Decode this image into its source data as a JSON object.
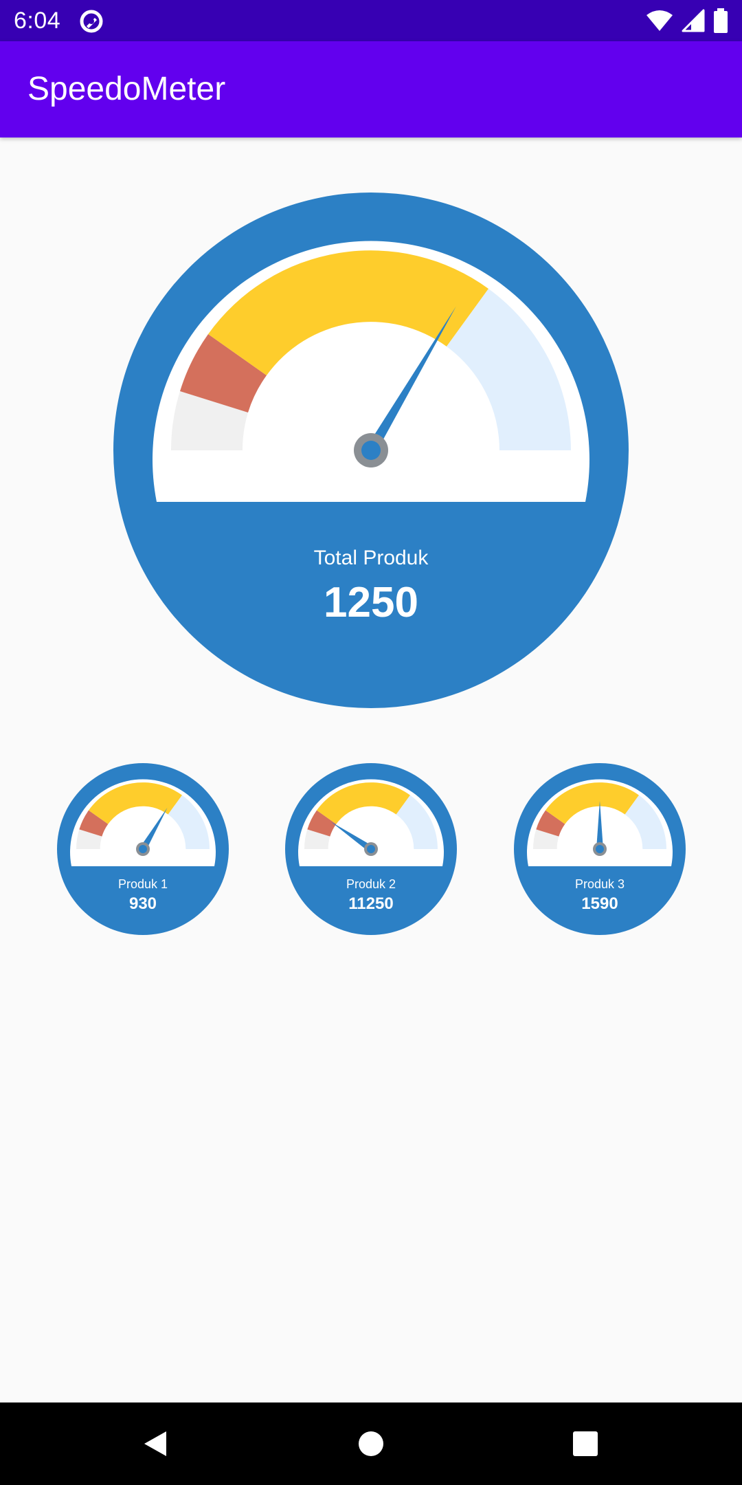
{
  "status_bar": {
    "time": "6:04",
    "icons": [
      "app-notification-icon",
      "wifi-icon",
      "cellular-signal-icon",
      "battery-icon"
    ]
  },
  "app_bar": {
    "title": "SpeedoMeter"
  },
  "colors": {
    "status_bar": "#3700b3",
    "app_bar": "#6200ee",
    "gauge_blue": "#2c80c5",
    "gauge_gray_zone": "#f0f0f0",
    "gauge_red_zone": "#d4705c",
    "gauge_yellow_zone": "#fecd2c",
    "gauge_light_blue_zone": "#e1effd",
    "needle_hub": "#8a8f94"
  },
  "main_gauge": {
    "label": "Total Produk",
    "value": "1250",
    "needle_fraction": 0.67
  },
  "small_gauges": [
    {
      "label": "Produk 1",
      "value": "930",
      "needle_fraction": 0.67
    },
    {
      "label": "Produk 2",
      "value": "11250",
      "needle_fraction": 0.19
    },
    {
      "label": "Produk 3",
      "value": "1590",
      "needle_fraction": 0.5
    }
  ],
  "nav_bar": {
    "buttons": [
      "back-icon",
      "home-icon",
      "recents-icon"
    ]
  }
}
